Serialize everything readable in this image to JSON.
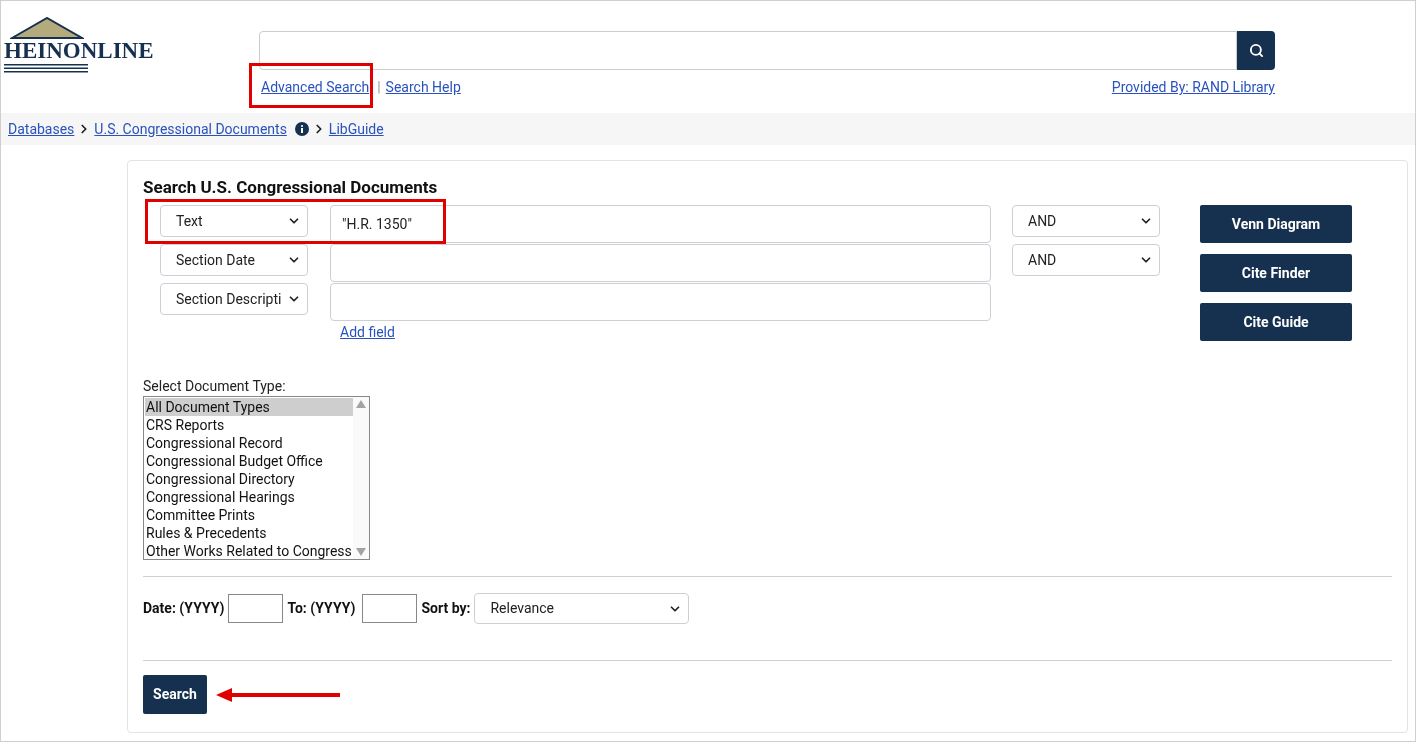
{
  "header": {
    "logo": "HEINONLINE",
    "links": [
      {
        "label": "Advanced Search",
        "highlighted": true
      },
      {
        "label": "Search Help",
        "highlighted": false
      }
    ],
    "separator": "|",
    "provided_by": "Provided By: RAND Library"
  },
  "breadcrumbs": [
    {
      "label": "Databases",
      "info": false
    },
    {
      "label": "U.S. Congressional Documents",
      "info": true
    },
    {
      "label": "LibGuide",
      "info": false
    }
  ],
  "form": {
    "title": "Search U.S. Congressional Documents",
    "rows": [
      {
        "field": "Text",
        "value": "\"H.R. 1350\"",
        "operator": "AND",
        "highlighted": true
      },
      {
        "field": "Section Date",
        "operator": "AND",
        "highlighted": false
      },
      {
        "field": "Section Descripti",
        "highlighted": false
      }
    ],
    "add_field": "Add field",
    "side_buttons": [
      "Venn Diagram",
      "Cite Finder",
      "Cite Guide"
    ],
    "doc_type_label": "Select Document Type:",
    "doc_types": [
      {
        "label": "All Document Types",
        "selected": true
      },
      {
        "label": "CRS Reports",
        "selected": false
      },
      {
        "label": "Congressional Record",
        "selected": false
      },
      {
        "label": "Congressional Budget Office",
        "selected": false
      },
      {
        "label": "Congressional Directory",
        "selected": false
      },
      {
        "label": "Congressional Hearings",
        "selected": false
      },
      {
        "label": "Committee Prints",
        "selected": false
      },
      {
        "label": "Rules & Precedents",
        "selected": false
      },
      {
        "label": "Other Works Related to Congress",
        "selected": false
      }
    ],
    "date_label": "Date: (YYYY)",
    "to_label": "To: (YYYY)",
    "sort_label": "Sort by:",
    "sort_value": "Relevance",
    "search_button": "Search",
    "search_arrow": true
  }
}
